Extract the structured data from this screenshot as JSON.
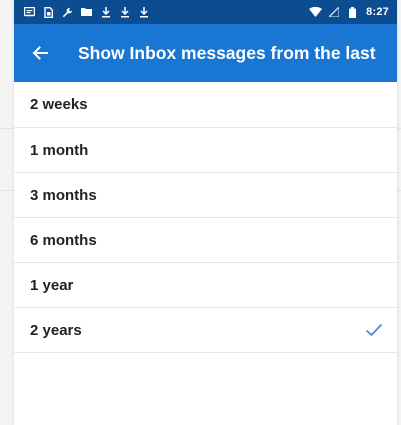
{
  "status_bar": {
    "time": "8:27",
    "left_icons": [
      "message-icon",
      "sim-icon",
      "wrench-icon",
      "folder-icon",
      "download-icon",
      "download-icon",
      "download-icon"
    ],
    "right_icons": [
      "wifi-icon",
      "signal-icon",
      "battery-icon"
    ]
  },
  "app_bar": {
    "title": "Show Inbox messages from the last",
    "back_icon": "arrow-left-icon",
    "background": "#1976d2"
  },
  "options": [
    {
      "label": "2 weeks",
      "selected": false
    },
    {
      "label": "1 month",
      "selected": false
    },
    {
      "label": "3 months",
      "selected": false
    },
    {
      "label": "6 months",
      "selected": false
    },
    {
      "label": "1 year",
      "selected": false
    },
    {
      "label": "2 years",
      "selected": true
    }
  ],
  "colors": {
    "status_bar": "#0c4c90",
    "accent": "#1976d2",
    "check": "#4a90d9"
  }
}
